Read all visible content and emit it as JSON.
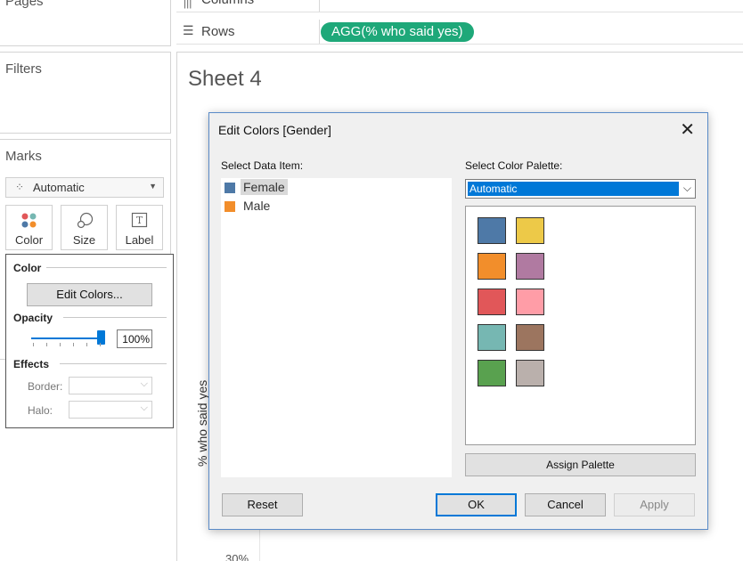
{
  "left": {
    "pages_title": "Pages",
    "filters_title": "Filters",
    "marks_title": "Marks",
    "mark_type": "Automatic",
    "mark_buttons": [
      {
        "label": "Color",
        "icon": "color-dots-icon"
      },
      {
        "label": "Size",
        "icon": "size-circles-icon"
      },
      {
        "label": "Label",
        "icon": "label-t-icon"
      }
    ]
  },
  "color_popup": {
    "color_section": "Color",
    "edit_colors_button": "Edit Colors...",
    "opacity_section": "Opacity",
    "opacity_value": "100%",
    "opacity_level": 1.0,
    "effects_section": "Effects",
    "border_label": "Border:",
    "halo_label": "Halo:"
  },
  "shelves": {
    "columns_label": "Columns",
    "rows_label": "Rows",
    "rows_pill": "AGG(% who said yes)",
    "pill_color": "#1ea879"
  },
  "sheet": {
    "title": "Sheet 4",
    "y_axis_label": "% who said yes",
    "y_tick": "30%"
  },
  "dialog": {
    "title": "Edit Colors [Gender]",
    "select_data_item_label": "Select Data Item:",
    "select_palette_label": "Select Color Palette:",
    "palette_selected": "Automatic",
    "data_items": [
      {
        "label": "Female",
        "color": "#4e79a7",
        "selected": true
      },
      {
        "label": "Male",
        "color": "#f28e2b",
        "selected": false
      }
    ],
    "palette_colors": [
      "#4e79a7",
      "#edc948",
      "#f28e2b",
      "#b07aa1",
      "#e15759",
      "#ff9da7",
      "#76b7b2",
      "#9c755f",
      "#59a14f",
      "#bab0ac"
    ],
    "assign_palette_button": "Assign Palette",
    "reset_button": "Reset",
    "ok_button": "OK",
    "cancel_button": "Cancel",
    "apply_button": "Apply"
  }
}
